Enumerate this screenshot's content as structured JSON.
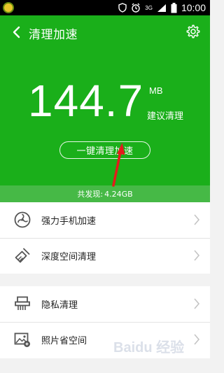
{
  "status": {
    "network": "3G",
    "time": "10:00"
  },
  "header": {
    "title": "清理加速"
  },
  "summary": {
    "size_value": "144.7",
    "size_unit": "MB",
    "hint": "建议清理",
    "clean_button_label": "一键清理加速",
    "found_label": "共发现:",
    "found_value": "4.24GB"
  },
  "list": {
    "group1": [
      {
        "label": "强力手机加速",
        "icon": "fan-icon"
      },
      {
        "label": "深度空间清理",
        "icon": "broom-icon"
      }
    ],
    "group2": [
      {
        "label": "隐私清理",
        "icon": "shredder-icon"
      },
      {
        "label": "照片省空间",
        "icon": "photo-icon"
      }
    ]
  },
  "watermark": {
    "text": "Baidu 经验"
  },
  "colors": {
    "primary_green": "#1aaf1a",
    "found_bar_green": "#46b946",
    "arrow_red": "#e31b1b"
  }
}
